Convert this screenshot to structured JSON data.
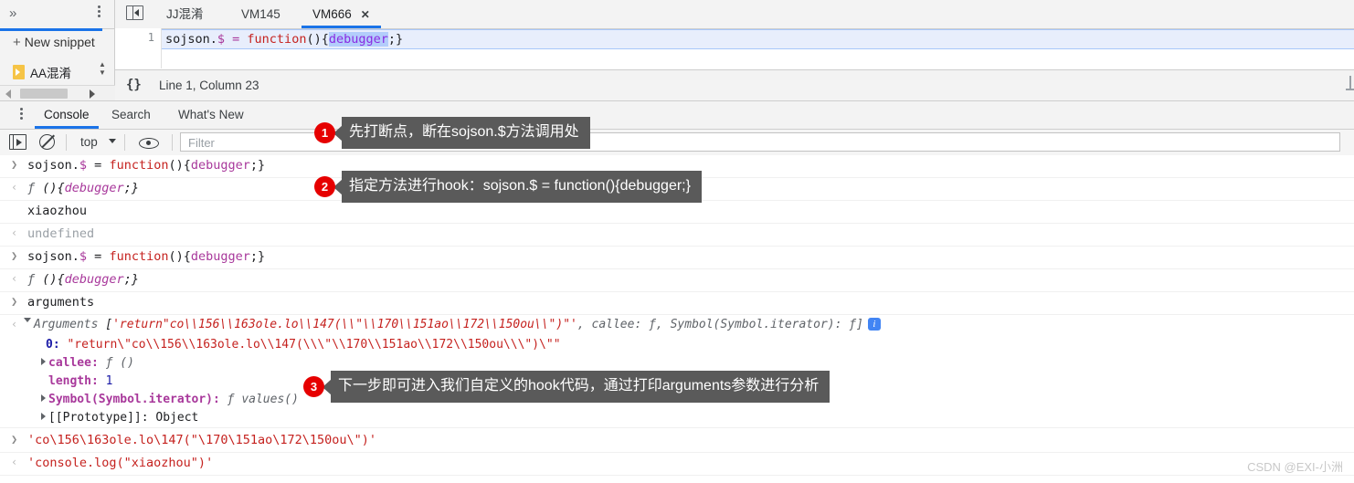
{
  "snippets": {
    "chevrons_icon": "double-chevron-right",
    "more_icon": "kebab-menu",
    "new_snippet_label": "New snippet",
    "new_snippet_plus": "+",
    "item_label": "AA混淆"
  },
  "sources": {
    "panel_icon": "collapse-panel-icon",
    "tabs": [
      {
        "label": "JJ混淆",
        "active": false,
        "closable": false
      },
      {
        "label": "VM145",
        "active": false,
        "closable": false
      },
      {
        "label": "VM666",
        "active": true,
        "closable": true,
        "close_glyph": "✕"
      }
    ],
    "line_number": "1",
    "code": {
      "part1": "sojson.",
      "part2": "$ = ",
      "keyword": "function",
      "part3": "(){",
      "selected": "debugger",
      "part4": ";}"
    },
    "status": {
      "format_icon": "{}",
      "position": "Line 1, Column 23"
    }
  },
  "drawer": {
    "more_icon": "kebab-menu",
    "tabs": [
      {
        "label": "Console",
        "active": true
      },
      {
        "label": "Search",
        "active": false
      },
      {
        "label": "What's New",
        "active": false
      }
    ],
    "toolbar": {
      "sidebar_icon": "console-sidebar-icon",
      "clear_icon": "clear-console-icon",
      "context_label": "top",
      "context_caret": "▼",
      "eye_icon": "live-expression-eye-icon",
      "filter_placeholder": "Filter"
    },
    "messages": [
      {
        "kind": "input",
        "glyph": "❯",
        "text": "sojson.$ = function(){debugger;}"
      },
      {
        "kind": "output",
        "glyph": "‹",
        "text": "ƒ (){debugger;}"
      },
      {
        "kind": "log",
        "glyph": "",
        "text": "xiaozhou"
      },
      {
        "kind": "output",
        "glyph": "‹",
        "text": "undefined"
      },
      {
        "kind": "input",
        "glyph": "❯",
        "text": "sojson.$ = function(){debugger;}"
      },
      {
        "kind": "output",
        "glyph": "‹",
        "text": "ƒ (){debugger;}"
      },
      {
        "kind": "input",
        "glyph": "❯",
        "text": "arguments"
      },
      {
        "kind": "output-object",
        "glyph": "‹",
        "label": "Arguments",
        "preview_open": " [",
        "preview_string": "'return\"co\\\\156\\\\163ole.lo\\\\147(\\\\\"\\\\170\\\\151ao\\\\172\\\\150ou\\\\\")\"'",
        "preview_rest": ", callee: ƒ, Symbol(Symbol.iterator): ƒ]",
        "info_badge": "i"
      },
      {
        "kind": "prop",
        "key": "0:",
        "value": "\"return\\\"co\\\\156\\\\163ole.lo\\\\147(\\\\\\\"\\\\170\\\\151ao\\\\172\\\\150ou\\\\\\\")\\\"\""
      },
      {
        "kind": "prop-expandable",
        "key": "callee:",
        "value": "ƒ ()"
      },
      {
        "kind": "prop-num",
        "key": "length:",
        "value": "1"
      },
      {
        "kind": "prop-expandable",
        "key": "Symbol(Symbol.iterator):",
        "value": "ƒ values()"
      },
      {
        "kind": "prop-expandable",
        "key": "[[Prototype]]:",
        "value": "Object"
      },
      {
        "kind": "input",
        "glyph": "❯",
        "text": "'co\\156\\163ole.lo\\147(\"\\170\\151ao\\172\\150ou\\\")'"
      },
      {
        "kind": "output",
        "glyph": "‹",
        "text": "'console.log(\"xiaozhou\")'"
      }
    ]
  },
  "callouts": [
    {
      "number": "1",
      "text": "先打断点，断在sojson.$方法调用处"
    },
    {
      "number": "2",
      "text": "指定方法进行hook：sojson.$ = function(){debugger;}"
    },
    {
      "number": "3",
      "text": "下一步即可进入我们自定义的hook代码，通过打印arguments参数进行分析"
    }
  ],
  "watermark": "CSDN @EXI-小洲"
}
